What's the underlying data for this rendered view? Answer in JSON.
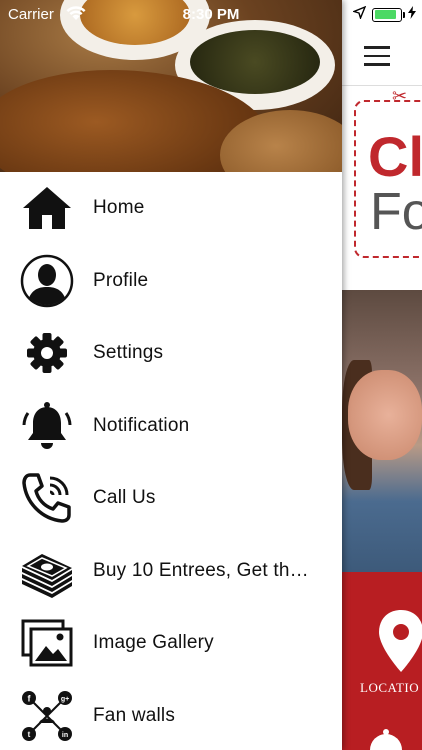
{
  "status_bar": {
    "carrier": "Carrier",
    "time": "8:30 PM",
    "battery_level": 0.85
  },
  "drawer": {
    "menu": [
      {
        "label": "Home",
        "icon": "home-icon"
      },
      {
        "label": "Profile",
        "icon": "profile-icon"
      },
      {
        "label": "Settings",
        "icon": "gear-icon"
      },
      {
        "label": "Notification",
        "icon": "bell-icon"
      },
      {
        "label": "Call Us",
        "icon": "phone-icon"
      },
      {
        "label": "Buy 10 Entrees, Get th…",
        "icon": "money-stack-icon"
      },
      {
        "label": "Image Gallery",
        "icon": "image-gallery-icon"
      },
      {
        "label": "Fan walls",
        "icon": "social-network-icon"
      }
    ]
  },
  "background_app": {
    "coupon_text_1": "Cl",
    "coupon_text_2": "Fo",
    "location_label": "LOCATIO",
    "accent_color": "#b81e22"
  }
}
